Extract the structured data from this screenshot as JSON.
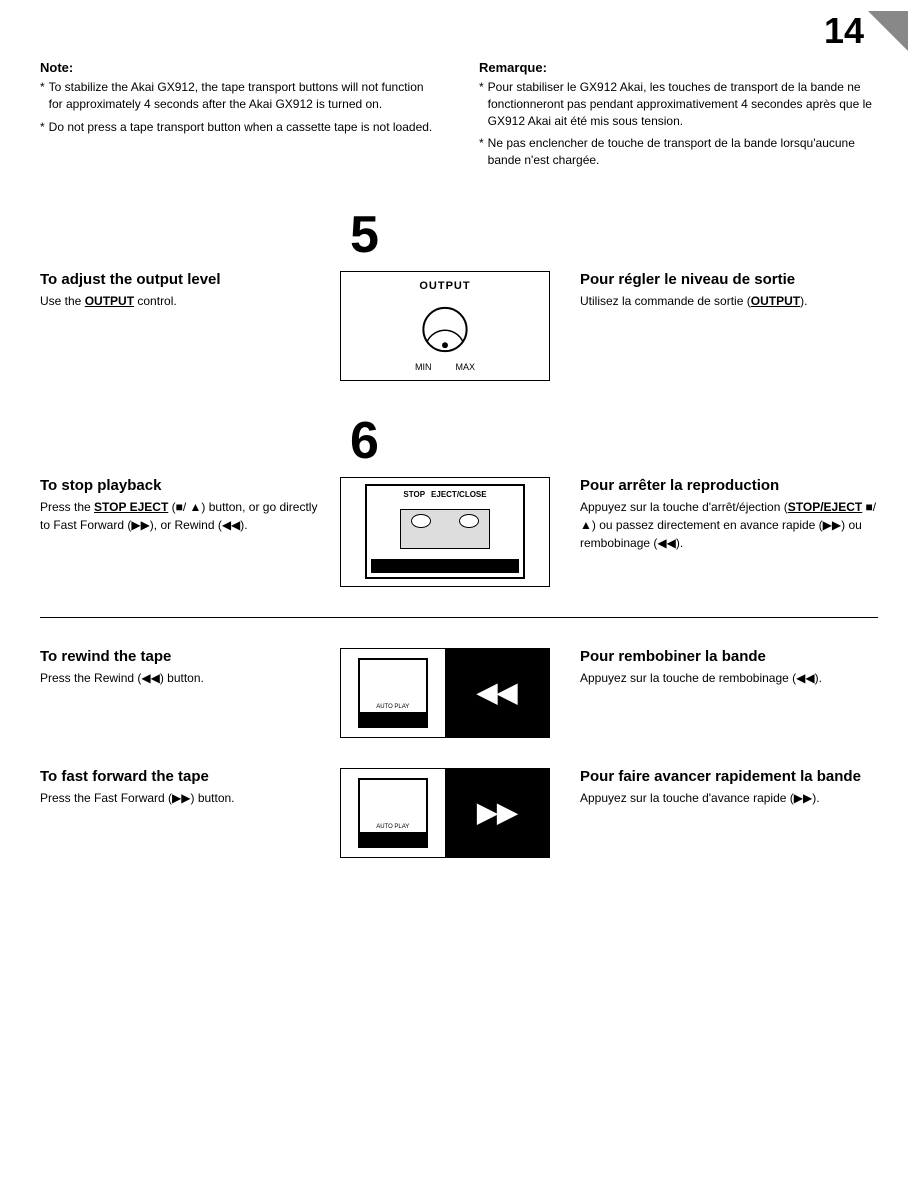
{
  "page": {
    "number": "14"
  },
  "notes": {
    "english": {
      "title": "Note:",
      "items": [
        "To stabilize the Akai GX912, the tape transport buttons will not function for approximately 4 seconds after the Akai GX912 is turned on.",
        "Do not press a tape transport button when a cassette tape is not loaded."
      ]
    },
    "french": {
      "title": "Remarque:",
      "items": [
        "Pour stabiliser le GX912 Akai, les touches de transport de la bande ne fonctionneront pas pendant approximativement 4 secondes après que le GX912 Akai ait été mis sous tension.",
        "Ne pas enclencher de touche de transport de la bande lorsqu'aucune bande n'est chargée."
      ]
    }
  },
  "steps": {
    "step5": {
      "number": "5",
      "english": {
        "title": "To adjust the output level",
        "description": "Use the OUTPUT control.",
        "output_label": "OUTPUT",
        "min_label": "MIN",
        "max_label": "MAX"
      },
      "french": {
        "title": "Pour régler le niveau de sortie",
        "description": "Utilisez la commande de sortie (OUTPUT)."
      }
    },
    "step6": {
      "number": "6",
      "english": {
        "title": "To stop playback",
        "description": "Press the STOP EJECT (■/ ▲) button, or go directly to Fast Forward (▶▶), or Rewind (◀◀).",
        "stop_label": "STOP",
        "eject_label": "EJECT/CLOSE"
      },
      "french": {
        "title": "Pour arrêter la reproduction",
        "description": "Appuyez sur la touche d'arrêt/éjection (STOP/EJECT ■/ ▲) ou passez directement en avance rapide (▶▶) ou rembobinage (◀◀)."
      }
    }
  },
  "subsections": {
    "rewind": {
      "english": {
        "title": "To rewind the tape",
        "description": "Press the Rewind (◀◀) button."
      },
      "french": {
        "title": "Pour rembobiner la bande",
        "description": "Appuyez sur la touche de rembobinage (◀◀)."
      },
      "icon": "◀◀"
    },
    "fastforward": {
      "english": {
        "title": "To fast forward the tape",
        "description": "Press the Fast Forward (▶▶) button."
      },
      "french": {
        "title": "Pour faire avancer rapidement la bande",
        "description": "Appuyez sur la touche d'avance rapide (▶▶)."
      },
      "icon": "▶▶"
    }
  }
}
